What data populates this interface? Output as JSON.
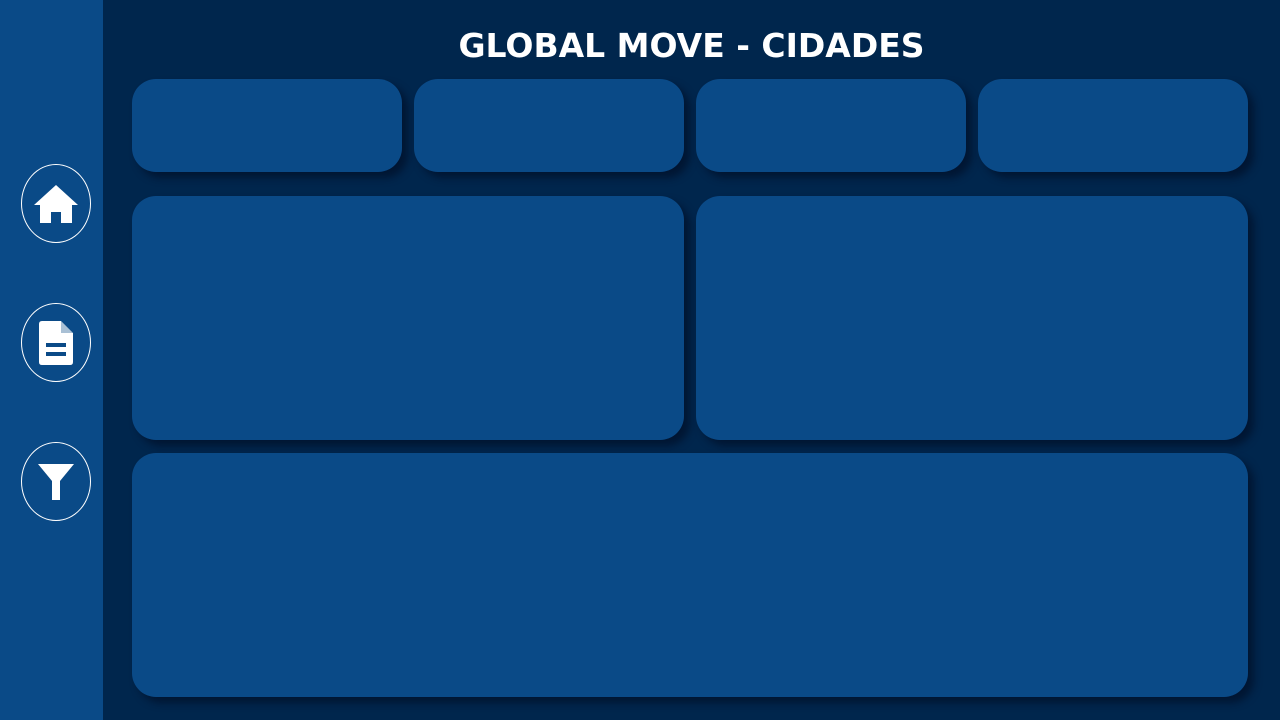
{
  "header": {
    "title": "GLOBAL MOVE - CIDADES"
  },
  "sidebar": {
    "items": [
      {
        "icon": "home-icon"
      },
      {
        "icon": "document-icon"
      },
      {
        "icon": "filter-icon"
      }
    ]
  },
  "colors": {
    "background": "#00264d",
    "sidebar": "#0a4a87",
    "card": "#0a4a87",
    "text": "#ffffff"
  }
}
